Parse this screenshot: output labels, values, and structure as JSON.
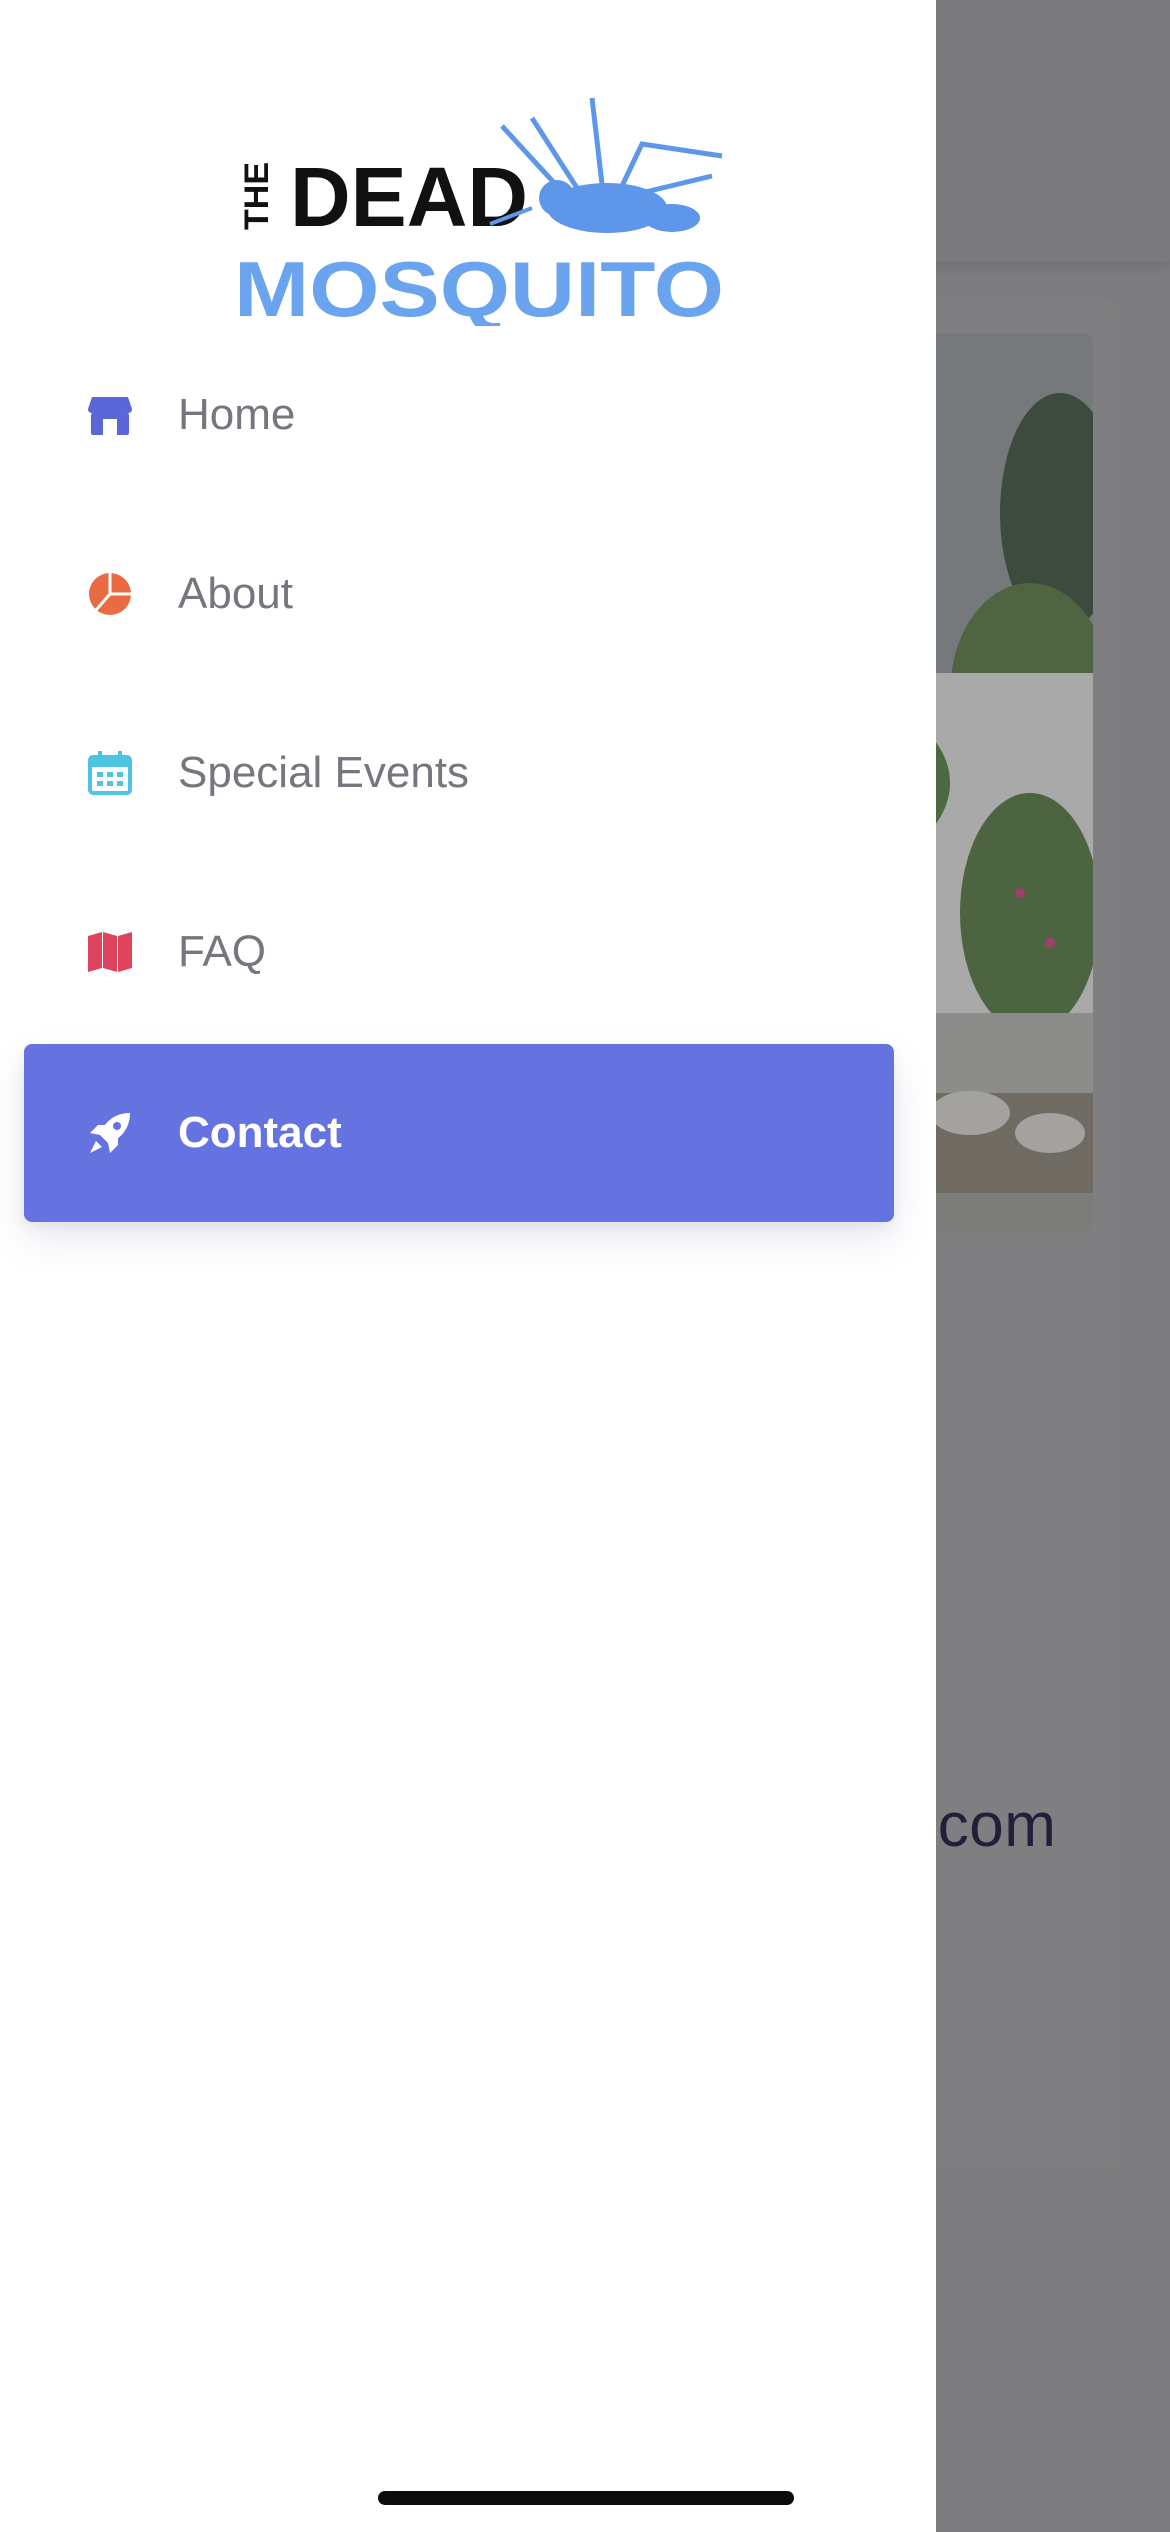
{
  "brand": {
    "logo_the": "THE",
    "logo_dead": "DEAD",
    "logo_mosquito": "MOSQUITO",
    "logo_dark_color": "#111111",
    "logo_blue_color": "#6aa3ee"
  },
  "menu": {
    "items": [
      {
        "label": "Home",
        "icon": "store-icon",
        "color": "#5b67d8"
      },
      {
        "label": "About",
        "icon": "pie-chart-icon",
        "color": "#ea6a43"
      },
      {
        "label": "Special Events",
        "icon": "calendar-icon",
        "color": "#4fc3e2"
      },
      {
        "label": "FAQ",
        "icon": "map-icon",
        "color": "#e0435d"
      },
      {
        "label": "Contact",
        "icon": "rocket-icon",
        "color": "#ffffff",
        "active": true
      }
    ],
    "active_bg": "#6473df"
  },
  "background_page": {
    "visible_text": ".com"
  }
}
